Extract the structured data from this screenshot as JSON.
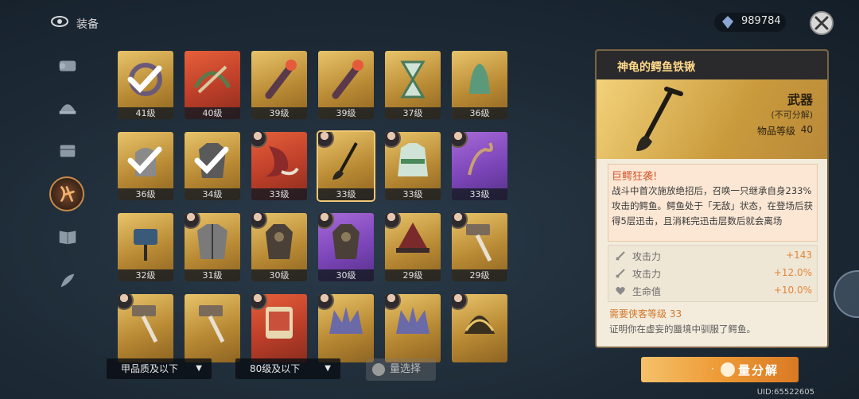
{
  "header": {
    "title": "装备",
    "currency_value": "989784"
  },
  "sidebar": {
    "items": [
      "scroll-icon",
      "helmet-icon",
      "chest-icon",
      "weapon-icon",
      "book-icon",
      "feather-icon"
    ],
    "active_index": 3
  },
  "items": [
    {
      "level": "41级",
      "rarity": "gold",
      "icon": "bracelet-icon",
      "checked": true,
      "avatar": false
    },
    {
      "level": "40级",
      "rarity": "red",
      "icon": "crossbow-icon",
      "checked": false,
      "avatar": false
    },
    {
      "level": "39级",
      "rarity": "gold",
      "icon": "torch-icon",
      "checked": false,
      "avatar": false
    },
    {
      "level": "39级",
      "rarity": "gold",
      "icon": "torch-icon",
      "checked": false,
      "avatar": false
    },
    {
      "level": "37级",
      "rarity": "gold",
      "icon": "hourglass-icon",
      "checked": false,
      "avatar": false
    },
    {
      "level": "36级",
      "rarity": "gold",
      "icon": "bell-icon",
      "checked": false,
      "avatar": false
    },
    {
      "level": "36级",
      "rarity": "gold",
      "icon": "glove-icon",
      "checked": true,
      "avatar": false
    },
    {
      "level": "34级",
      "rarity": "gold",
      "icon": "coat-icon",
      "checked": true,
      "avatar": false
    },
    {
      "level": "33级",
      "rarity": "red",
      "icon": "claw-icon",
      "checked": false,
      "avatar": true
    },
    {
      "level": "33级",
      "rarity": "gold",
      "icon": "shovel-icon",
      "checked": false,
      "avatar": true,
      "selected": true
    },
    {
      "level": "33级",
      "rarity": "gold",
      "icon": "robe-icon",
      "checked": false,
      "avatar": true
    },
    {
      "level": "33级",
      "rarity": "purple",
      "icon": "rope-icon",
      "checked": false,
      "avatar": true
    },
    {
      "level": "32级",
      "rarity": "gold",
      "icon": "tassel-icon",
      "checked": false,
      "avatar": false
    },
    {
      "level": "31级",
      "rarity": "gold",
      "icon": "jacket-icon",
      "checked": false,
      "avatar": true
    },
    {
      "level": "30级",
      "rarity": "gold",
      "icon": "armor-icon",
      "checked": false,
      "avatar": true
    },
    {
      "level": "30级",
      "rarity": "purple",
      "icon": "armor-icon",
      "checked": false,
      "avatar": true
    },
    {
      "level": "29级",
      "rarity": "gold",
      "icon": "hat-icon",
      "checked": false,
      "avatar": true
    },
    {
      "level": "29级",
      "rarity": "gold",
      "icon": "hammer-icon",
      "checked": false,
      "avatar": true
    },
    {
      "level": "",
      "rarity": "gold",
      "icon": "hammer-icon",
      "checked": false,
      "avatar": true
    },
    {
      "level": "",
      "rarity": "gold",
      "icon": "hammer-icon",
      "checked": false,
      "avatar": false
    },
    {
      "level": "",
      "rarity": "red",
      "icon": "scroll-icon",
      "checked": false,
      "avatar": true
    },
    {
      "level": "",
      "rarity": "gold",
      "icon": "crown-icon",
      "checked": false,
      "avatar": true
    },
    {
      "level": "",
      "rarity": "gold",
      "icon": "crown-icon",
      "checked": false,
      "avatar": true
    },
    {
      "level": "",
      "rarity": "gold",
      "icon": "helmet-icon",
      "checked": false,
      "avatar": true
    }
  ],
  "filters": {
    "quality": "甲品质及以下",
    "level": "80级及以下",
    "batch_select": "量选择"
  },
  "detail": {
    "title": "神龟的鳄鱼铁锹",
    "type": "武器",
    "note": "(不可分解)",
    "level_label": "物品等级",
    "level_value": "40",
    "skill_title": "巨鳄狂袭!",
    "skill_desc": "战斗中首次施放绝招后，召唤一只继承自身233%攻击的鳄鱼。鳄鱼处于「无敌」状态，在登场后获得5层迅击，且消耗完迅击层数后就会离场",
    "stats": [
      {
        "label": "攻击力",
        "value": "+143",
        "icon": "sword-icon"
      },
      {
        "label": "攻击力",
        "value": "+12.0%",
        "icon": "sword-icon"
      },
      {
        "label": "生命值",
        "value": "+10.0%",
        "icon": "heart-icon"
      }
    ],
    "requirement": "需要侠客等级 33",
    "proof": "证明你在虚妄的蜃境中驯服了鳄鱼。"
  },
  "actions": {
    "decompose": "量分解"
  },
  "footer": {
    "uid": "UID:65522605"
  },
  "colors": {
    "gold": "#c99a3c",
    "red": "#c0402a",
    "purple": "#7b45b8",
    "accent": "#ee9a36"
  }
}
